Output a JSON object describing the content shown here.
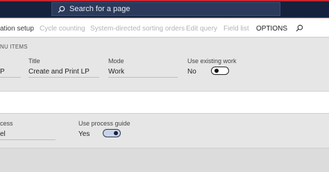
{
  "search": {
    "placeholder": "Search for a page"
  },
  "actions": [
    {
      "label": "ation setup",
      "state": "enabled"
    },
    {
      "label": "Cycle counting",
      "state": "disabled"
    },
    {
      "label": "System-directed sorting orders",
      "state": "disabled"
    },
    {
      "label": "Edit query",
      "state": "disabled"
    },
    {
      "label": "Field list",
      "state": "disabled"
    },
    {
      "label": "OPTIONS",
      "state": "selected"
    }
  ],
  "menu_items": {
    "section_label": "NU ITEMS",
    "menu_item_value": "P",
    "title_label": "Title",
    "title_value": "Create and Print LP",
    "mode_label": "Mode",
    "mode_value": "Work",
    "use_existing_work_label": "Use existing work",
    "use_existing_work_value": "No",
    "use_existing_work_on": false
  },
  "general": {
    "process_label": "cess",
    "process_value": "el",
    "use_process_guide_label": "Use process guide",
    "use_process_guide_value": "Yes",
    "use_process_guide_on": true
  }
}
